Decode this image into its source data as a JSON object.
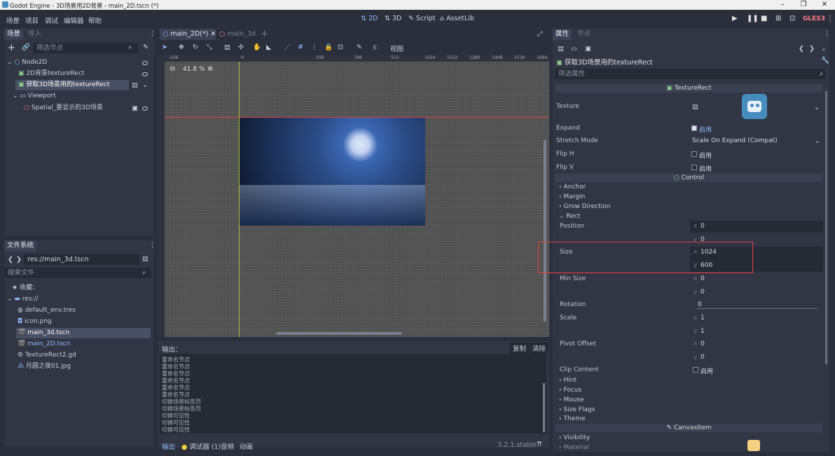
{
  "window": {
    "title": "Godot Engine - 3D场景用2D背景 - main_2D.tscn (*)"
  },
  "menu": [
    "场景",
    "项目",
    "调试",
    "编辑器",
    "帮助"
  ],
  "modes": {
    "two_d": "2D",
    "three_d": "3D",
    "script": "Script",
    "assetlib": "AssetLib"
  },
  "renderer": "GLES3",
  "scene_panel": {
    "tabs": [
      "场景",
      "导入"
    ],
    "filter_placeholder": "筛选节点",
    "nodes": [
      {
        "label": "Node2D"
      },
      {
        "label": "2D背景textureRect"
      },
      {
        "label": "获取3D场景用的textureRect"
      },
      {
        "label": "Viewport"
      },
      {
        "label": "Spatial_要显示的3D场景"
      }
    ]
  },
  "filesystem": {
    "title": "文件系统",
    "path": "res://main_3d.tscn",
    "search_placeholder": "搜索文件",
    "favorites": "收藏：",
    "root": "res://",
    "files": [
      "default_env.tres",
      "icon.png",
      "main_3d.tscn",
      "main_2D.tscn",
      "TextureRect2.gd",
      "月圆之夜01.jpg"
    ]
  },
  "editor_tabs": [
    "main_2D(*)",
    "main_3d"
  ],
  "toolbar": {
    "view_label": "视图"
  },
  "viewport": {
    "zoom": "41.8 %",
    "rulers": [
      "-256",
      "0",
      "256",
      "512",
      "768",
      "1024",
      "1152",
      "1280",
      "1408",
      "1536",
      "1664"
    ],
    "vrulers": [
      "0",
      "256",
      "512"
    ]
  },
  "output": {
    "title": "输出：",
    "copy": "复制",
    "clear": "清除",
    "lines": [
      "重命名节点",
      "重命名节点",
      "重命名节点",
      "重命名节点",
      "重命名节点",
      "重命名节点",
      "切换场景标签页",
      "切换场景标签页",
      "切换可见性",
      "切换可见性",
      "切换可见性"
    ],
    "bottom_tabs": [
      "输出",
      "调试器 (1)",
      "音频",
      "动画"
    ],
    "version": "3.2.1.stable"
  },
  "inspector": {
    "tabs": [
      "属性",
      "节点"
    ],
    "node_path": "获取3D场景用的textureRect",
    "filter_placeholder": "筛选属性",
    "sections": {
      "texture_rect": "TextureRect",
      "control": "Control",
      "canvas_item": "CanvasItem"
    },
    "enable": "启用",
    "props": {
      "texture": "Texture",
      "expand": "Expand",
      "stretch_mode": "Stretch Mode",
      "stretch_value": "Scale On Expand (Compat)",
      "flip_h": "Flip H",
      "flip_v": "Flip V"
    },
    "groups": [
      "Anchor",
      "Margin",
      "Grow Direction",
      "Rect"
    ],
    "rect": {
      "position": "Position",
      "pos_x": "0",
      "pos_y": "0",
      "size": "Size",
      "size_x": "1024",
      "size_y": "600",
      "min_size": "Min Size",
      "min_x": "0",
      "min_y": "0",
      "rotation": "Rotation",
      "rotation_val": "0",
      "scale": "Scale",
      "scale_x": "1",
      "scale_y": "1",
      "pivot": "Pivot Offset",
      "pivot_x": "0",
      "pivot_y": "0",
      "clip": "Clip Content"
    },
    "control_groups": [
      "Hint",
      "Focus",
      "Mouse",
      "Size Flags",
      "Theme"
    ],
    "canvas_groups": [
      "Visibility",
      "Material"
    ],
    "axis_x": "x",
    "axis_y": "y"
  },
  "colors": {
    "highlight": "#e04040",
    "accent": "#8fb8ff",
    "background": "#2b2f3c"
  }
}
